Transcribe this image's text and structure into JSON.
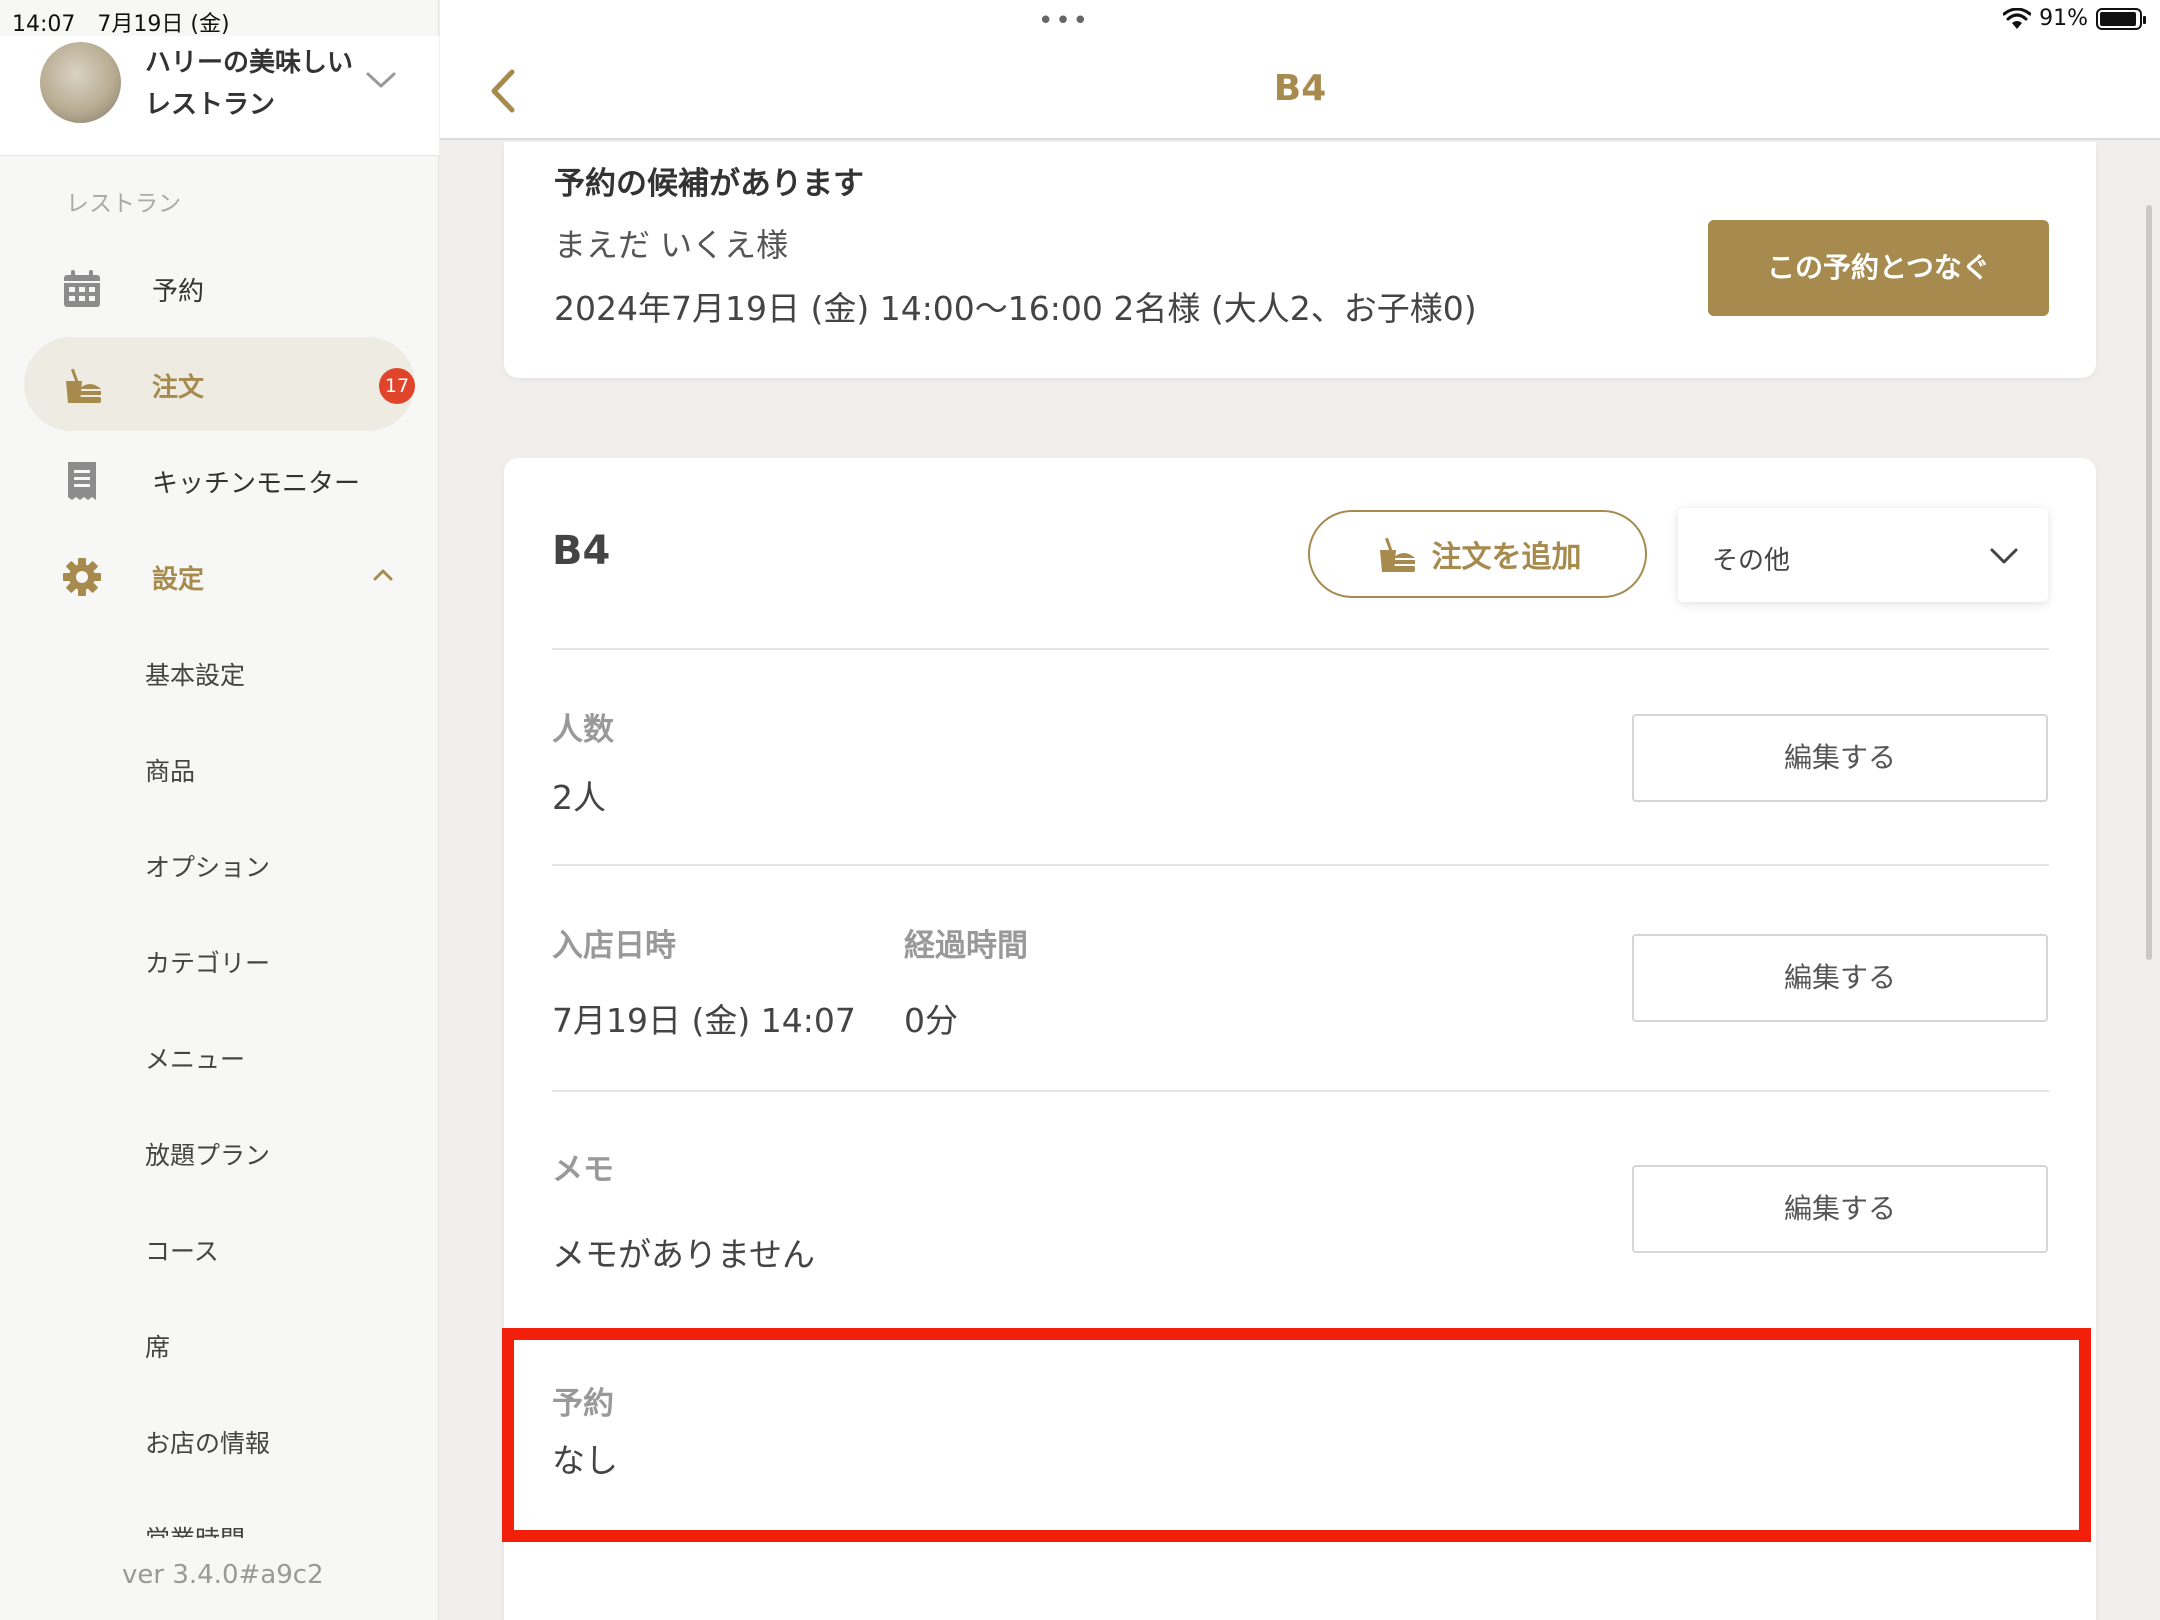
{
  "status_bar": {
    "time_date": "14:07　7月19日 (金)",
    "battery": "91%"
  },
  "sidebar": {
    "shop_name": "ハリーの美味しいレストラン",
    "section_label": "レストラン",
    "nav": [
      {
        "label": "予約",
        "icon": "calendar-icon"
      },
      {
        "label": "注文",
        "icon": "order-icon",
        "badge": "17"
      },
      {
        "label": "キッチンモニター",
        "icon": "receipt-icon"
      },
      {
        "label": "設定",
        "icon": "gear-icon"
      }
    ],
    "settings_items": [
      "基本設定",
      "商品",
      "オプション",
      "カテゴリー",
      "メニュー",
      "放題プラン",
      "コース",
      "席",
      "お店の情報",
      "営業時間"
    ],
    "version": "ver 3.4.0#a9c2"
  },
  "header": {
    "title": "B4",
    "dots": "•••"
  },
  "reservation_candidate": {
    "title": "予約の候補があります",
    "customer": "まえだ いくえ様",
    "details": "2024年7月19日 (金) 14:00～16:00 2名様 (大人2、お子様0)",
    "link_button": "この予約とつなぐ"
  },
  "table": {
    "name": "B4",
    "add_order": "注文を追加",
    "other_select": "その他",
    "guests": {
      "label": "人数",
      "value": "2人",
      "edit": "編集する"
    },
    "entry": {
      "label": "入店日時",
      "value": "7月19日 (金) 14:07",
      "elapsed_label": "経過時間",
      "elapsed_value": "0分",
      "edit": "編集する"
    },
    "memo": {
      "label": "メモ",
      "value": "メモがありません",
      "edit": "編集する"
    },
    "reservation": {
      "label": "予約",
      "value": "なし"
    }
  },
  "colors": {
    "accent": "#a68a4e",
    "badge": "#e0452c",
    "highlight": "#f2200a"
  }
}
